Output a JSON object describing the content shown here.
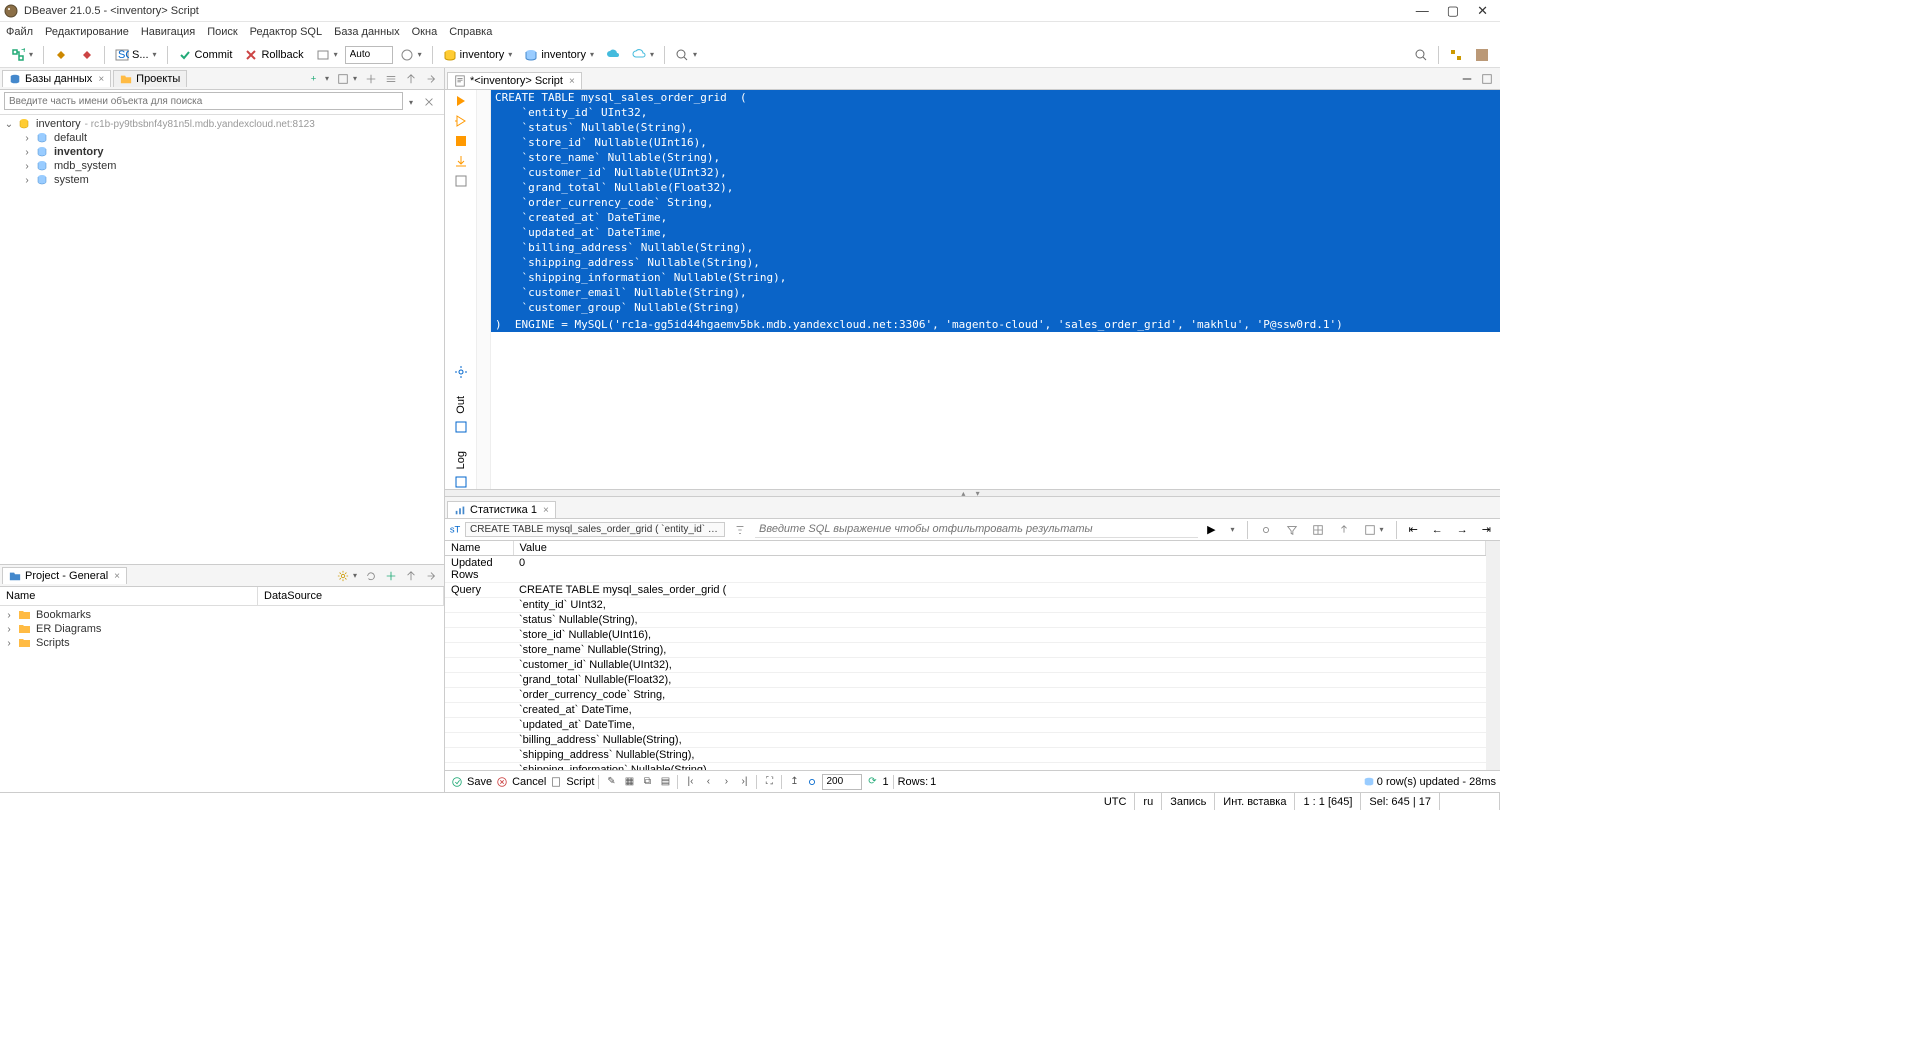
{
  "title": "DBeaver 21.0.5 - <inventory> Script",
  "menu": [
    "Файл",
    "Редактирование",
    "Навигация",
    "Поиск",
    "Редактор SQL",
    "База данных",
    "Окна",
    "Справка"
  ],
  "toolbar": {
    "sql_label": "S...",
    "commit": "Commit",
    "rollback": "Rollback",
    "mode": "Auto",
    "db1": "inventory",
    "db2": "inventory"
  },
  "left_tabs": {
    "databases": "Базы данных",
    "projects": "Проекты"
  },
  "search_placeholder": "Введите часть имени объекта для поиска",
  "tree": {
    "root": "inventory",
    "root_hint": "- rc1b-py9tbsbnf4y81n5l.mdb.yandexcloud.net:8123",
    "children": [
      "default",
      "inventory",
      "mdb_system",
      "system"
    ]
  },
  "project_panel": {
    "title": "Project - General",
    "cols": [
      "Name",
      "DataSource"
    ],
    "items": [
      "Bookmarks",
      "ER Diagrams",
      "Scripts"
    ]
  },
  "editor": {
    "tab": "*<inventory> Script",
    "side_out": "Out",
    "side_log": "Log",
    "code": [
      "CREATE TABLE mysql_sales_order_grid  (",
      "    `entity_id` UInt32,",
      "    `status` Nullable(String),",
      "    `store_id` Nullable(UInt16),",
      "    `store_name` Nullable(String),",
      "    `customer_id` Nullable(UInt32),",
      "    `grand_total` Nullable(Float32),",
      "    `order_currency_code` String,",
      "    `created_at` DateTime,",
      "    `updated_at` DateTime,",
      "    `billing_address` Nullable(String),",
      "    `shipping_address` Nullable(String),",
      "    `shipping_information` Nullable(String),",
      "    `customer_email` Nullable(String),",
      "    `customer_group` Nullable(String)",
      "",
      ")  ENGINE = MySQL('rc1a-gg5id44hgaemv5bk.mdb.yandexcloud.net:3306', 'magento-cloud', 'sales_order_grid', 'makhlu', 'P@ssw0rd.1')"
    ]
  },
  "stats": {
    "tab": "Статистика 1",
    "chip": "CREATE TABLE mysql_sales_order_grid ( `entity_id` UInt32,",
    "filter_placeholder": "Введите SQL выражение чтобы отфильтровать результаты",
    "col_name": "Name",
    "col_value": "Value",
    "rows": [
      {
        "name": "Updated Rows",
        "value": "0"
      },
      {
        "name": "Query",
        "value": "CREATE TABLE mysql_sales_order_grid  ("
      }
    ],
    "query_lines": [
      "    `entity_id` UInt32,",
      "    `status` Nullable(String),",
      "    `store_id` Nullable(UInt16),",
      "    `store_name` Nullable(String),",
      "    `customer_id` Nullable(UInt32),",
      "    `grand_total` Nullable(Float32),",
      "    `order_currency_code` String,",
      "    `created_at` DateTime,",
      "    `updated_at` DateTime,",
      "    `billing_address` Nullable(String),",
      "    `shipping_address` Nullable(String),",
      "    `shipping_information` Nullable(String),"
    ]
  },
  "bottom": {
    "save": "Save",
    "cancel": "Cancel",
    "script": "Script",
    "page_size": "200",
    "rows_prefix": "Rows:",
    "rows_count": "1",
    "msg": "0 row(s) updated - 28ms"
  },
  "status": {
    "tz": "UTC",
    "lang": "ru",
    "mode1": "Запись",
    "mode2": "Инт. вставка",
    "pos": "1 : 1 [645]",
    "sel": "Sel: 645 | 17"
  }
}
